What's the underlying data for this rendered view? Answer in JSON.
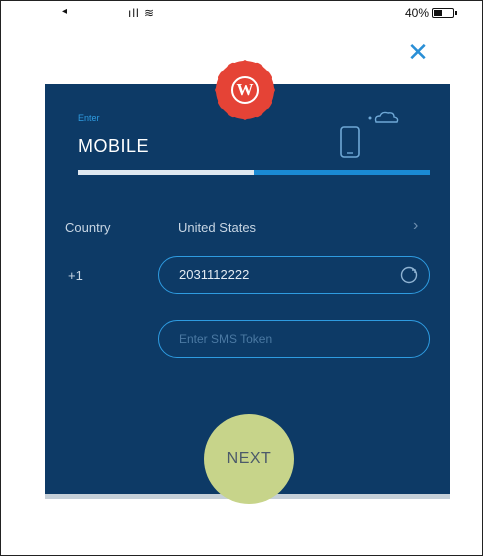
{
  "status_bar": {
    "location_glyph": "◂",
    "signal_glyph": "ıll ≋",
    "battery_percent": "40%",
    "battery_level": 0.4
  },
  "close_label": "✕",
  "badge_letter": "W",
  "form": {
    "enter_label": "Enter",
    "field_title": "MOBILE",
    "progress": 0.5,
    "country_label": "Country",
    "country_value": "United States",
    "country_chevron": "›",
    "dial_code": "+1",
    "phone_value": "2031112222",
    "sms_placeholder": "Enter SMS Token",
    "next_label": "NEXT"
  },
  "colors": {
    "card": "#0d3a66",
    "accent": "#2e9be0",
    "badge": "#e54336",
    "next": "#c7d48a"
  }
}
